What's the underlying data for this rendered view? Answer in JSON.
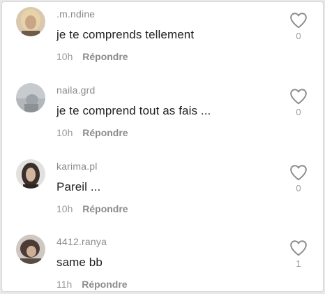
{
  "comments": [
    {
      "username": ".m.ndine",
      "text": "je te comprends tellement",
      "time": "10h",
      "reply_label": "Répondre",
      "likes": "0",
      "avatar_colors": {
        "bg": "#d9c8b0",
        "hair": "#e8d3a8",
        "face": "#c9a588"
      }
    },
    {
      "username": "naila.grd",
      "text": "je te comprend tout as fais ...",
      "time": "10h",
      "reply_label": "Répondre",
      "likes": "0",
      "avatar_colors": {
        "bg": "#c7cbcf",
        "hair": "#9ea3a8",
        "face": "#b9bdc1"
      }
    },
    {
      "username": "karima.pl",
      "text": "Pareil ...",
      "time": "10h",
      "reply_label": "Répondre",
      "likes": "0",
      "avatar_colors": {
        "bg": "#e3e1df",
        "hair": "#3a2f2a",
        "face": "#d2b59e"
      }
    },
    {
      "username": "4412.ranya",
      "text": "same bb",
      "time": "11h",
      "reply_label": "Répondre",
      "likes": "1",
      "avatar_colors": {
        "bg": "#cfc7c2",
        "hair": "#4a3b34",
        "face": "#cfae97"
      }
    }
  ],
  "icons": {
    "like": "heart-outline-icon"
  },
  "colors": {
    "username": "#8a8a8a",
    "text": "#222222",
    "meta": "#9a9a9a",
    "heart_stroke": "#8c8c8c"
  }
}
